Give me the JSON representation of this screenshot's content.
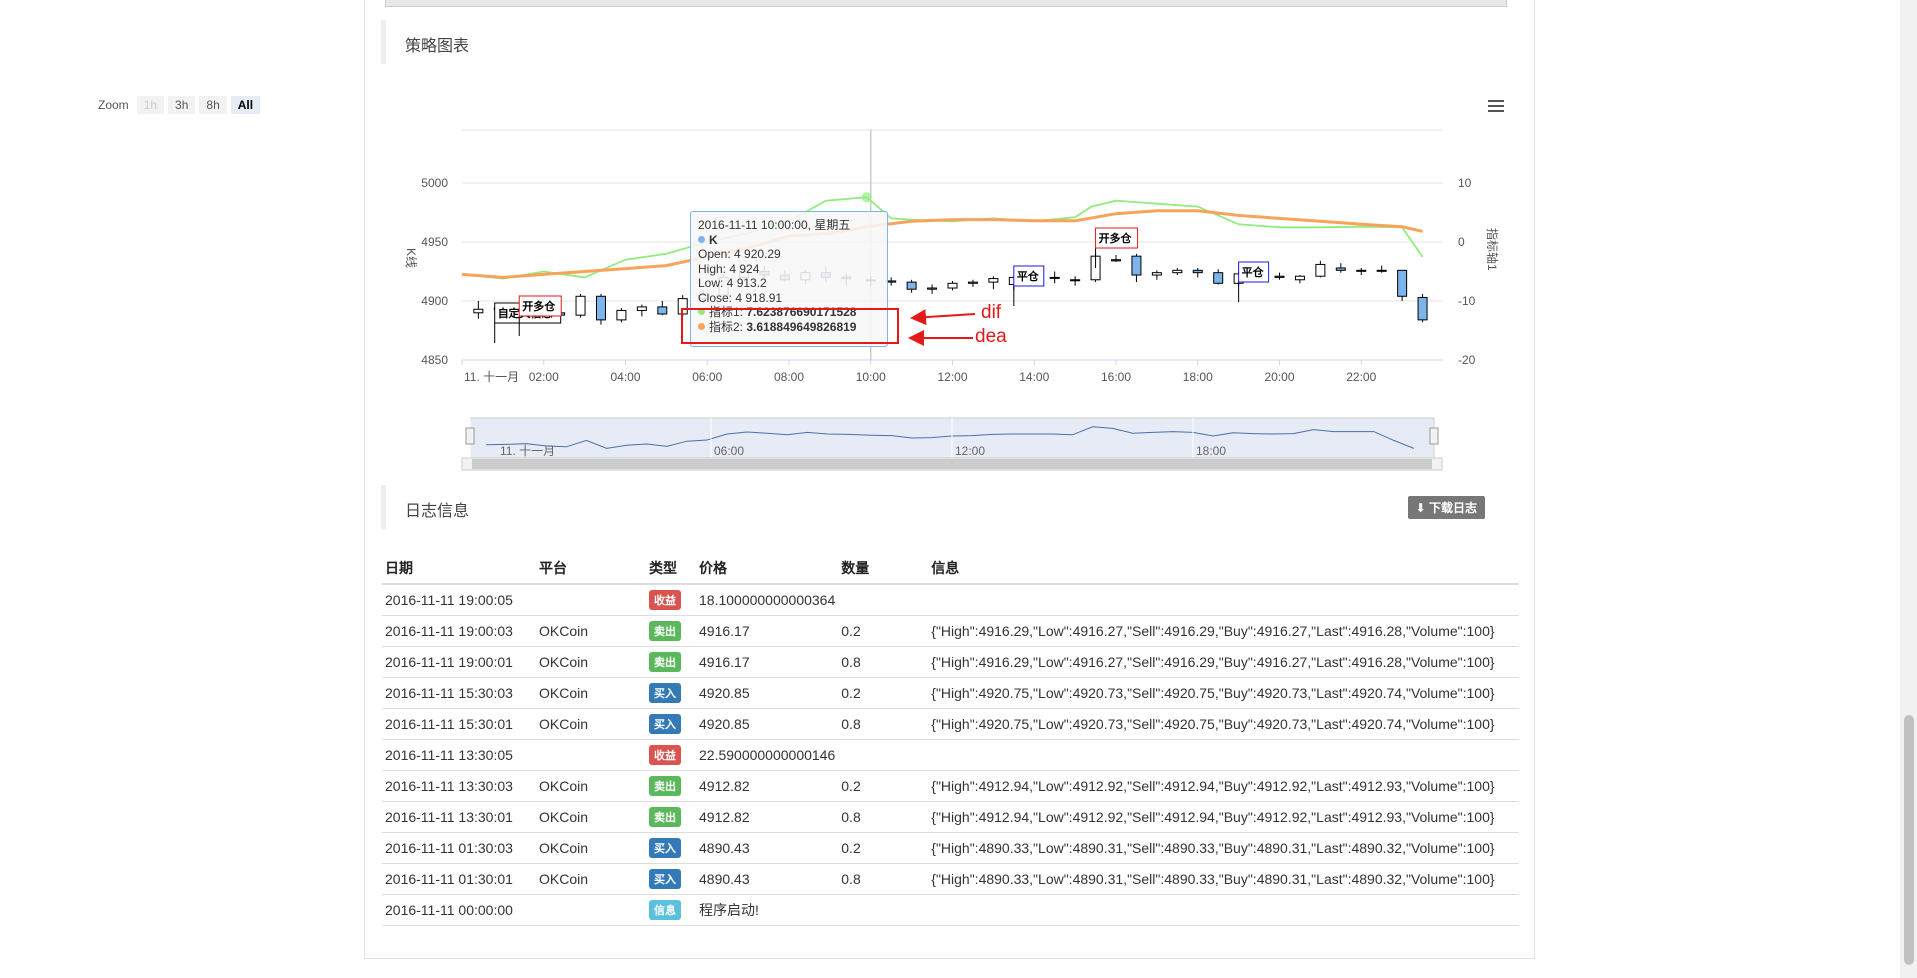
{
  "sections": {
    "chart_title": "策略图表",
    "log_title": "日志信息",
    "download_label": "下载日志"
  },
  "zoom": {
    "label": "Zoom",
    "buttons": [
      "1h",
      "3h",
      "8h",
      "All"
    ],
    "selected": "All"
  },
  "chart_data": {
    "type": "candlestick",
    "x_ticks": [
      "11. 十一月",
      "02:00",
      "04:00",
      "06:00",
      "08:00",
      "10:00",
      "12:00",
      "14:00",
      "16:00",
      "18:00",
      "20:00",
      "22:00"
    ],
    "left_axis": {
      "label": "K线",
      "ticks": [
        "5000",
        "4950",
        "4900",
        "4850"
      ],
      "range": [
        4850,
        5000
      ]
    },
    "right_axis": {
      "label": "指标轴1",
      "ticks": [
        "10",
        "0",
        "-10",
        "-20"
      ],
      "range": [
        -20,
        10
      ]
    },
    "navigator_ticks": [
      "11. 十一月",
      "06:00",
      "12:00",
      "18:00"
    ],
    "flags": [
      {
        "label": "自定义信息",
        "time": 0.8
      },
      {
        "label": "开多仓",
        "time": 1.4
      },
      {
        "label": "平仓",
        "time": 13.5
      },
      {
        "label": "开多仓",
        "time": 15.5
      },
      {
        "label": "平仓",
        "time": 19.0
      }
    ],
    "series": [
      {
        "name": "K",
        "color": "#7cb5ec"
      },
      {
        "name": "指标1",
        "color": "#90ed7d"
      },
      {
        "name": "指标2",
        "color": "#f7a35c"
      }
    ],
    "dif": [
      [
        0,
        -5.5
      ],
      [
        1,
        -6.2
      ],
      [
        2,
        -5
      ],
      [
        3,
        -6
      ],
      [
        4,
        -3
      ],
      [
        5,
        -2
      ],
      [
        6,
        0
      ],
      [
        7,
        1.5
      ],
      [
        8,
        3.5
      ],
      [
        8.9,
        7
      ],
      [
        9.9,
        7.6
      ],
      [
        10.5,
        4
      ],
      [
        11,
        3.8
      ],
      [
        12,
        3.5
      ],
      [
        13,
        4
      ],
      [
        14,
        3.5
      ],
      [
        15,
        4.2
      ],
      [
        15.4,
        6
      ],
      [
        16,
        7
      ],
      [
        17,
        6.5
      ],
      [
        18,
        6
      ],
      [
        19,
        3
      ],
      [
        20,
        2.5
      ],
      [
        21,
        2.5
      ],
      [
        22,
        2.6
      ],
      [
        23,
        2.5
      ],
      [
        23.5,
        -2.5
      ]
    ],
    "dea": [
      [
        0,
        -5.5
      ],
      [
        1,
        -6
      ],
      [
        2,
        -5.5
      ],
      [
        3,
        -5
      ],
      [
        4,
        -4.5
      ],
      [
        5,
        -4
      ],
      [
        6,
        -2.5
      ],
      [
        7,
        -1
      ],
      [
        8,
        1
      ],
      [
        9,
        1.5
      ],
      [
        10,
        2.7
      ],
      [
        11,
        3.5
      ],
      [
        12,
        3.8
      ],
      [
        13,
        3.8
      ],
      [
        14,
        3.6
      ],
      [
        15,
        3.6
      ],
      [
        16,
        4.8
      ],
      [
        17,
        5.3
      ],
      [
        18,
        5.3
      ],
      [
        19,
        4.5
      ],
      [
        20,
        4
      ],
      [
        21,
        3.5
      ],
      [
        22,
        3
      ],
      [
        23,
        2.6
      ],
      [
        23.5,
        1.8
      ]
    ],
    "candles": [
      [
        0.4,
        4890,
        4900,
        4885,
        4893
      ],
      [
        0.9,
        4893,
        4897,
        4890,
        4894
      ],
      [
        1.4,
        4894,
        4898,
        4890,
        4896
      ],
      [
        1.9,
        4896,
        4898,
        4886,
        4890
      ],
      [
        2.4,
        4890,
        4895,
        4882,
        4888
      ],
      [
        2.9,
        4888,
        4906,
        4886,
        4904
      ],
      [
        3.4,
        4904,
        4906,
        4880,
        4884
      ],
      [
        3.9,
        4884,
        4894,
        4882,
        4892
      ],
      [
        4.4,
        4892,
        4897,
        4887,
        4895
      ],
      [
        4.9,
        4895,
        4900,
        4888,
        4889
      ],
      [
        5.4,
        4889,
        4905,
        4887,
        4902
      ],
      [
        5.9,
        4902,
        4910,
        4898,
        4905
      ],
      [
        6.4,
        4905,
        4922,
        4903,
        4920
      ],
      [
        6.9,
        4920,
        4928,
        4918,
        4925
      ],
      [
        7.4,
        4925,
        4930,
        4920,
        4922
      ],
      [
        7.9,
        4922,
        4926,
        4916,
        4918
      ],
      [
        8.4,
        4918,
        4926,
        4914,
        4924
      ],
      [
        8.9,
        4924,
        4929,
        4916,
        4920
      ],
      [
        9.4,
        4920.29,
        4924,
        4913.2,
        4918.91
      ],
      [
        10.0,
        4918,
        4921,
        4912,
        4917
      ],
      [
        10.5,
        4917,
        4920,
        4913,
        4916
      ],
      [
        11.0,
        4916,
        4918,
        4907,
        4910
      ],
      [
        11.5,
        4910,
        4914,
        4906,
        4911
      ],
      [
        12.0,
        4911,
        4917,
        4909,
        4915
      ],
      [
        12.5,
        4915,
        4918,
        4912,
        4916
      ],
      [
        13.0,
        4916,
        4921,
        4910,
        4919
      ],
      [
        13.5,
        4914,
        4920,
        4909,
        4920
      ],
      [
        14.0,
        4917,
        4922,
        4915,
        4920
      ],
      [
        14.5,
        4920,
        4925,
        4915,
        4920
      ],
      [
        15.0,
        4918,
        4921,
        4913,
        4918
      ],
      [
        15.5,
        4918,
        4940,
        4916,
        4938
      ],
      [
        16.0,
        4935,
        4939,
        4933,
        4934
      ],
      [
        16.5,
        4938,
        4940,
        4916,
        4922
      ],
      [
        17.0,
        4922,
        4926,
        4918,
        4924
      ],
      [
        17.5,
        4924,
        4928,
        4922,
        4926
      ],
      [
        18.0,
        4926,
        4928,
        4920,
        4924
      ],
      [
        18.5,
        4924,
        4927,
        4914,
        4915
      ],
      [
        19.0,
        4915,
        4925,
        4913,
        4923
      ],
      [
        19.5,
        4920,
        4924,
        4917,
        4921
      ],
      [
        20.0,
        4921,
        4924,
        4918,
        4920
      ],
      [
        20.5,
        4918,
        4922,
        4915,
        4921
      ],
      [
        21.0,
        4921,
        4934,
        4920,
        4931
      ],
      [
        21.5,
        4928,
        4932,
        4924,
        4926
      ],
      [
        22.0,
        4926,
        4928,
        4922,
        4926
      ],
      [
        22.5,
        4926,
        4930,
        4924,
        4926
      ],
      [
        23.0,
        4926,
        4926,
        4900,
        4904
      ],
      [
        23.5,
        4903,
        4906,
        4882,
        4884
      ]
    ],
    "tooltip": {
      "header": "2016-11-11 10:00:00, 星期五",
      "series_name": "K",
      "open": "Open: 4 920.29",
      "high": "High: 4 924",
      "low": "Low: 4 913.2",
      "close": "Close: 4 918.91",
      "ind1_label": "指标1:",
      "ind1_value": "7.623876690171528",
      "ind2_label": "指标2:",
      "ind2_value": "3.618849649826819"
    }
  },
  "annotations": {
    "dif": "dif",
    "dea": "dea"
  },
  "log_table": {
    "headers": [
      "日期",
      "平台",
      "类型",
      "价格",
      "数量",
      "信息"
    ],
    "rows": [
      {
        "date": "2016-11-11 19:00:05",
        "platform": "",
        "type": "收益",
        "type_color": "#d9534f",
        "price": "18.100000000000364",
        "qty": "",
        "info": ""
      },
      {
        "date": "2016-11-11 19:00:03",
        "platform": "OKCoin",
        "type": "卖出",
        "type_color": "#5cb85c",
        "price": "4916.17",
        "qty": "0.2",
        "info": "{\"High\":4916.29,\"Low\":4916.27,\"Sell\":4916.29,\"Buy\":4916.27,\"Last\":4916.28,\"Volume\":100}"
      },
      {
        "date": "2016-11-11 19:00:01",
        "platform": "OKCoin",
        "type": "卖出",
        "type_color": "#5cb85c",
        "price": "4916.17",
        "qty": "0.8",
        "info": "{\"High\":4916.29,\"Low\":4916.27,\"Sell\":4916.29,\"Buy\":4916.27,\"Last\":4916.28,\"Volume\":100}"
      },
      {
        "date": "2016-11-11 15:30:03",
        "platform": "OKCoin",
        "type": "买入",
        "type_color": "#337ab7",
        "price": "4920.85",
        "qty": "0.2",
        "info": "{\"High\":4920.75,\"Low\":4920.73,\"Sell\":4920.75,\"Buy\":4920.73,\"Last\":4920.74,\"Volume\":100}"
      },
      {
        "date": "2016-11-11 15:30:01",
        "platform": "OKCoin",
        "type": "买入",
        "type_color": "#337ab7",
        "price": "4920.85",
        "qty": "0.8",
        "info": "{\"High\":4920.75,\"Low\":4920.73,\"Sell\":4920.75,\"Buy\":4920.73,\"Last\":4920.74,\"Volume\":100}"
      },
      {
        "date": "2016-11-11 13:30:05",
        "platform": "",
        "type": "收益",
        "type_color": "#d9534f",
        "price": "22.590000000000146",
        "qty": "",
        "info": ""
      },
      {
        "date": "2016-11-11 13:30:03",
        "platform": "OKCoin",
        "type": "卖出",
        "type_color": "#5cb85c",
        "price": "4912.82",
        "qty": "0.2",
        "info": "{\"High\":4912.94,\"Low\":4912.92,\"Sell\":4912.94,\"Buy\":4912.92,\"Last\":4912.93,\"Volume\":100}"
      },
      {
        "date": "2016-11-11 13:30:01",
        "platform": "OKCoin",
        "type": "卖出",
        "type_color": "#5cb85c",
        "price": "4912.82",
        "qty": "0.8",
        "info": "{\"High\":4912.94,\"Low\":4912.92,\"Sell\":4912.94,\"Buy\":4912.92,\"Last\":4912.93,\"Volume\":100}"
      },
      {
        "date": "2016-11-11 01:30:03",
        "platform": "OKCoin",
        "type": "买入",
        "type_color": "#337ab7",
        "price": "4890.43",
        "qty": "0.2",
        "info": "{\"High\":4890.33,\"Low\":4890.31,\"Sell\":4890.33,\"Buy\":4890.31,\"Last\":4890.32,\"Volume\":100}"
      },
      {
        "date": "2016-11-11 01:30:01",
        "platform": "OKCoin",
        "type": "买入",
        "type_color": "#337ab7",
        "price": "4890.43",
        "qty": "0.8",
        "info": "{\"High\":4890.33,\"Low\":4890.31,\"Sell\":4890.33,\"Buy\":4890.31,\"Last\":4890.32,\"Volume\":100}"
      },
      {
        "date": "2016-11-11 00:00:00",
        "platform": "",
        "type": "信息",
        "type_color": "#5bc0de",
        "price": "程序启动!",
        "qty": "",
        "info": ""
      }
    ]
  }
}
